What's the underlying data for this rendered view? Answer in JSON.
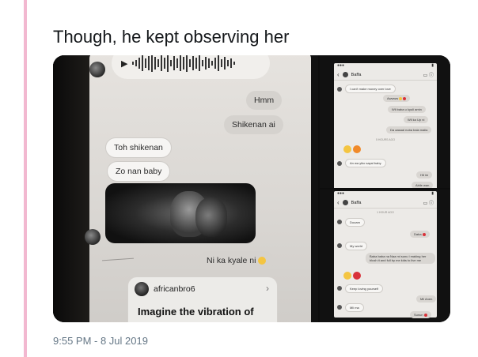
{
  "tweet": {
    "text": "Though, he kept observing her",
    "timestamp": "9:55 PM - 8 Jul 2019"
  },
  "main_photo": {
    "messages": {
      "hmm": "Hmm",
      "shikenan": "Shikenan ai",
      "toh": "Toh shikenan",
      "zo": "Zo nan baby",
      "nika": "Ni ka kyale ni"
    },
    "shared_post": {
      "username": "africanbro6",
      "caption": "Imagine the vibration of"
    }
  },
  "mini_top": {
    "header_name": "Baffa",
    "messages": {
      "m1": "I can't make money over love",
      "m2": "Awwww",
      "m3": "Wli baba u kyuli amin",
      "m4": "Wli ka Up ni",
      "m5": "Da aasaal nuba bala malia",
      "time": "5 HOURS AGO",
      "m6": "An wa yiko sayal baby",
      "m7": "Hit im",
      "m8": "Abile wan"
    }
  },
  "mini_bottom": {
    "header_name": "Baffa",
    "messages": {
      "time": "1 HOUR AGO",
      "m1": "Dooam",
      "m2": "Daba",
      "m3": "My world",
      "m4": "Baba baba na Naa mi sunu i making her blush it and full by me kids to live me",
      "m5": "Keep loving yourself",
      "m6": "Mli Anen",
      "m7": "Mli ma",
      "m8": "Sunun"
    }
  },
  "colors": {
    "thread_line": "#f2b8d0",
    "text": "#14171a",
    "muted": "#657786",
    "heart_red": "#d9323a"
  }
}
